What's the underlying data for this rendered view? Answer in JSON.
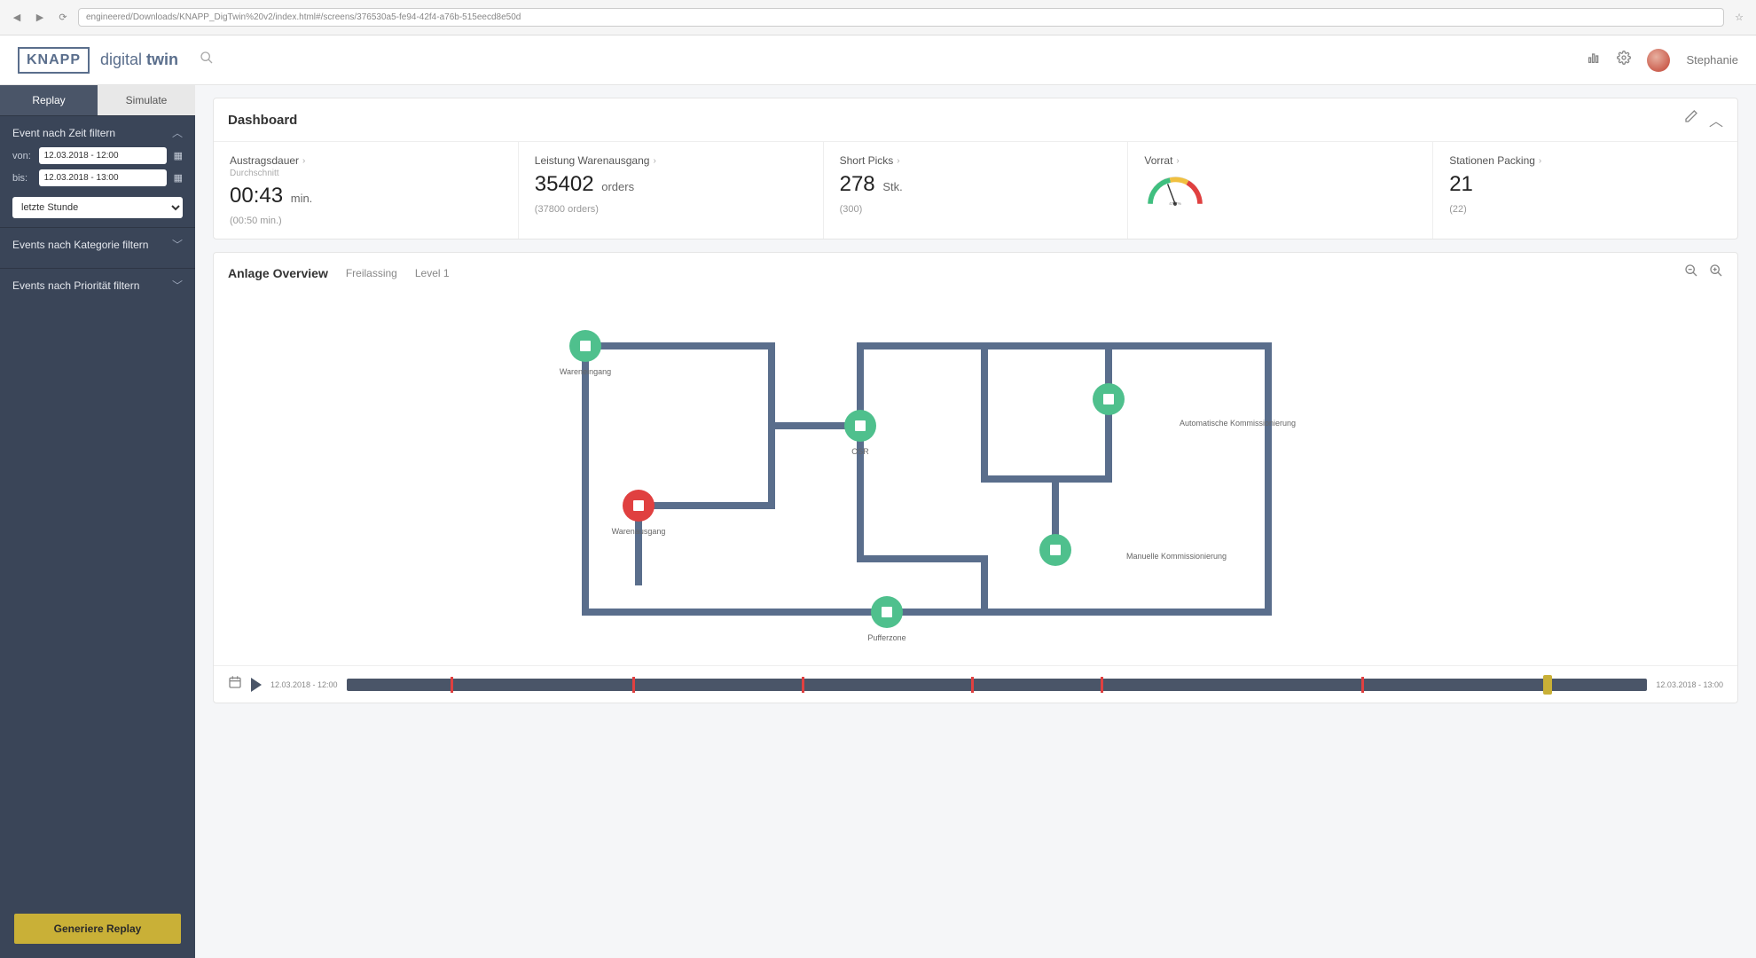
{
  "browser": {
    "url": "engineered/Downloads/KNAPP_DigTwin%20v2/index.html#/screens/376530a5-fe94-42f4-a76b-515eecd8e50d"
  },
  "header": {
    "brand": "KNAPP",
    "product_prefix": "digital ",
    "product_suffix": "twin",
    "username": "Stephanie"
  },
  "sidebar": {
    "tabs": {
      "replay": "Replay",
      "simulate": "Simulate"
    },
    "filter_time_title": "Event nach Zeit filtern",
    "from_label": "von:",
    "to_label": "bis:",
    "from_value": "12.03.2018 - 12:00",
    "to_value": "12.03.2018 - 13:00",
    "range_select": "letzte Stunde",
    "filter_category_title": "Events nach Kategorie filtern",
    "filter_priority_title": "Events nach Priorität filtern",
    "generate_replay": "Generiere Replay"
  },
  "dashboard": {
    "title": "Dashboard",
    "kpis": [
      {
        "label": "Austragsdauer",
        "sub": "Durchschnitt",
        "value": "00:43",
        "unit": "min.",
        "ref": "(00:50 min.)"
      },
      {
        "label": "Leistung Warenausgang",
        "sub": "",
        "value": "35402",
        "unit": "orders",
        "ref": "(37800 orders)"
      },
      {
        "label": "Short Picks",
        "sub": "",
        "value": "278",
        "unit": "Stk.",
        "ref": "(300)"
      },
      {
        "label": "Vorrat",
        "sub": "",
        "value": "",
        "unit": "",
        "ref": "",
        "gauge": "47.7%"
      },
      {
        "label": "Stationen Packing",
        "sub": "",
        "value": "21",
        "unit": "",
        "ref": "(22)"
      }
    ]
  },
  "overview": {
    "title": "Anlage Overview",
    "breadcrumb": [
      "Freilassing",
      "Level 1"
    ],
    "nodes": {
      "wareneingang": "Wareneingang",
      "osr": "OSR",
      "auto_komm": "Automatische Kommissionierung",
      "warenausgang": "Warenausgang",
      "manuelle_komm": "Manuelle Kommissionierung",
      "pufferzone": "Pufferzone"
    }
  },
  "timeline": {
    "start": "12.03.2018 - 12:00",
    "end": "12.03.2018 - 13:00",
    "markers_pct": [
      8,
      22,
      35,
      48,
      58,
      78
    ],
    "playhead_pct": 92
  }
}
